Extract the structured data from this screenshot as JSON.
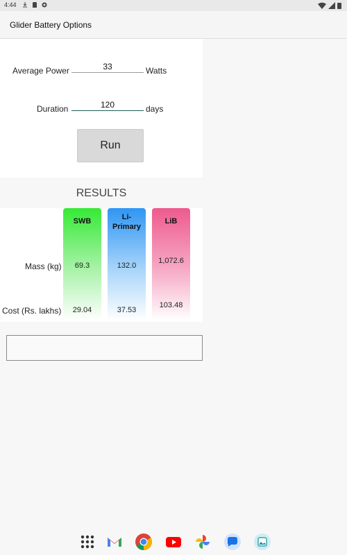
{
  "status": {
    "time": "4:44"
  },
  "app": {
    "title": "Glider Battery Options"
  },
  "form": {
    "power_label": "Average Power",
    "power_value": "33",
    "power_unit": "Watts",
    "duration_label": "Duration",
    "duration_value": "120",
    "duration_unit": "days",
    "run_label": "Run"
  },
  "results": {
    "title": "RESULTS",
    "row_labels": {
      "mass": "Mass (kg)",
      "cost": "Cost (Rs. lakhs)"
    },
    "columns": [
      {
        "name": "SWB",
        "mass": "69.3",
        "cost": "29.04",
        "color": "#36ea36"
      },
      {
        "name": "Li-Primary",
        "mass": "132.0",
        "cost": "37.53",
        "color": "#2f96f3"
      },
      {
        "name": "LiB",
        "mass": "1,072.6",
        "cost": "103.48",
        "color": "#ee5a8e"
      }
    ]
  },
  "dock": {
    "apps": [
      "app-drawer-icon",
      "gmail-icon",
      "chrome-icon",
      "youtube-icon",
      "photos-icon",
      "messages-icon",
      "gallery-icon"
    ]
  }
}
